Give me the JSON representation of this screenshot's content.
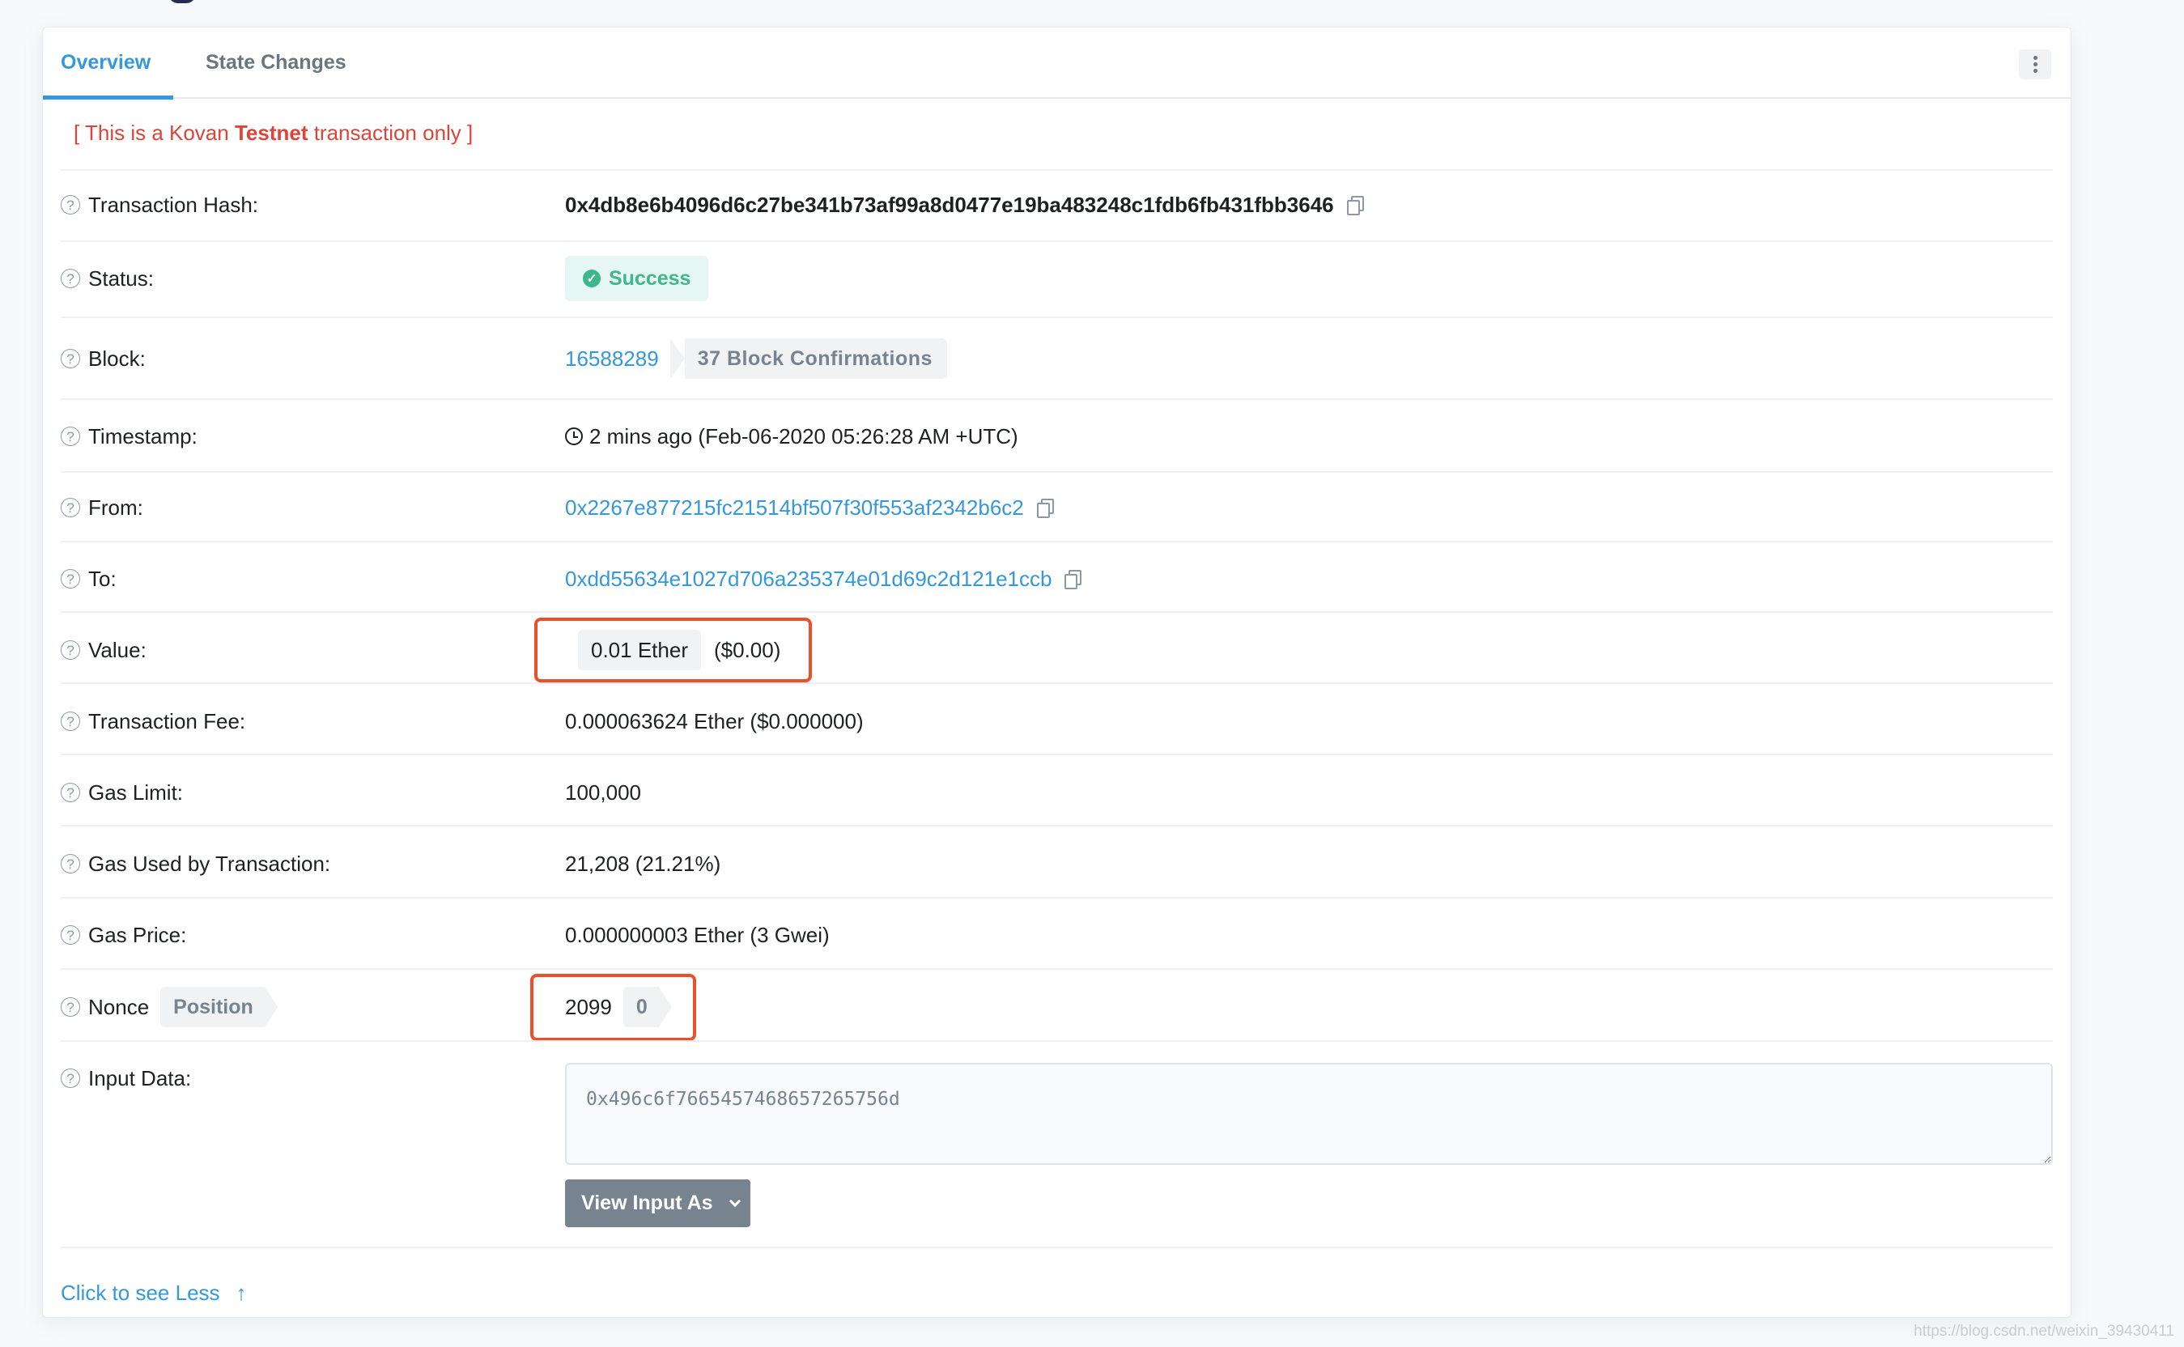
{
  "tabs": [
    {
      "label": "Overview",
      "active": true
    },
    {
      "label": "State Changes",
      "active": false
    }
  ],
  "more_menu": {
    "icon": "kebab-vertical-icon"
  },
  "notice": {
    "prefix": "[ This is a Kovan ",
    "bold": "Testnet",
    "suffix": " transaction only ]"
  },
  "fields": {
    "tx_hash": {
      "label": "Transaction Hash:",
      "value": "0x4db8e6b4096d6c27be341b73af99a8d0477e19ba483248c1fdb6fb431fbb3646"
    },
    "status": {
      "label": "Status:",
      "value": "Success"
    },
    "block": {
      "label": "Block:",
      "value": "16588289",
      "confirmations": "37 Block Confirmations"
    },
    "timestamp": {
      "label": "Timestamp:",
      "value": "2 mins ago (Feb-06-2020 05:26:28 AM +UTC)"
    },
    "from": {
      "label": "From:",
      "value": "0x2267e877215fc21514bf507f30f553af2342b6c2"
    },
    "to": {
      "label": "To:",
      "value": "0xdd55634e1027d706a235374e01d69c2d121e1ccb"
    },
    "value": {
      "label": "Value:",
      "amount": "0.01 Ether",
      "usd": "($0.00)"
    },
    "tx_fee": {
      "label": "Transaction Fee:",
      "value": "0.000063624 Ether ($0.000000)"
    },
    "gas_limit": {
      "label": "Gas Limit:",
      "value": "100,000"
    },
    "gas_used": {
      "label": "Gas Used by Transaction:",
      "value": "21,208 (21.21%)"
    },
    "gas_price": {
      "label": "Gas Price:",
      "value": "0.000000003 Ether (3 Gwei)"
    },
    "nonce": {
      "label": "Nonce",
      "position_label": "Position",
      "value": "2099",
      "position": "0"
    },
    "input_data": {
      "label": "Input Data:",
      "value": "0x496c6f7665457468657265756d"
    }
  },
  "view_input_button": "View Input As",
  "see_less_link": "Click to see Less",
  "watermark": "https://blog.csdn.net/weixin_39430411",
  "colors": {
    "accent": "#3498db",
    "success": "#3fb68b",
    "testnet_red": "#de4437",
    "highlight": "#e8512a"
  }
}
